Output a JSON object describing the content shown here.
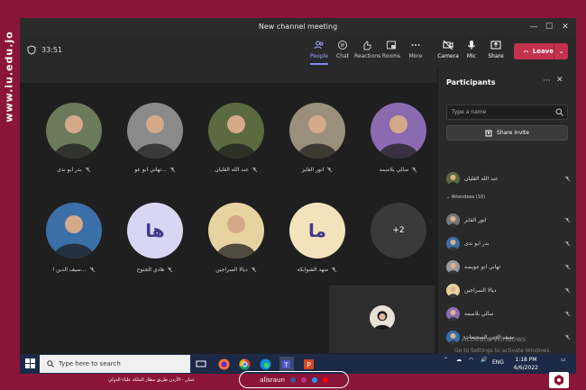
{
  "side_text": "www.iu.edu.jo",
  "window": {
    "title": "New channel meeting",
    "min": "—",
    "max": "☐",
    "close": "✕"
  },
  "toolbar": {
    "timer": "33:51",
    "buttons": [
      {
        "label": "People",
        "icon": "people-icon"
      },
      {
        "label": "Chat",
        "icon": "chat-icon"
      },
      {
        "label": "Reactions",
        "icon": "reactions-icon"
      },
      {
        "label": "Rooms",
        "icon": "rooms-icon"
      },
      {
        "label": "More",
        "icon": "more-icon"
      },
      {
        "label": "Camera",
        "icon": "camera-off-icon"
      },
      {
        "label": "Mic",
        "icon": "mic-icon"
      },
      {
        "label": "Share",
        "icon": "share-icon"
      }
    ],
    "leave_label": "Leave"
  },
  "tiles": [
    {
      "name": "بدر ابو ندى",
      "kind": "photo",
      "color": "#6b7a5a"
    },
    {
      "name": "تهاني ابو عو...",
      "kind": "photo",
      "color": "#8a8a8a"
    },
    {
      "name": "عبد الله القليان",
      "kind": "photo",
      "color": "#5b6a3f"
    },
    {
      "name": "انور الفايز",
      "kind": "photo",
      "color": "#9a8f7a"
    },
    {
      "name": "سالي بلاسمه",
      "kind": "photo",
      "color": "#8a6bb0"
    },
    {
      "name": "سيف الدين ا...",
      "kind": "photo",
      "color": "#3a6fa8"
    },
    {
      "name": "هادي الجنوح",
      "kind": "initials",
      "initials": "ها",
      "color": "#d8d6f2"
    },
    {
      "name": "ديالا السراجين",
      "kind": "photo",
      "color": "#e7d3a0"
    },
    {
      "name": "سهد الشوابكه",
      "kind": "initials",
      "initials": "ما",
      "color": "#f3e3bc"
    },
    {
      "name": "",
      "kind": "overflow",
      "initials": "+2",
      "color": "#3a3a3a"
    }
  ],
  "participants": {
    "title": "Participants",
    "search_placeholder": "Type a name",
    "share_invite": "Share invite",
    "organizer": "عبد الله القليان",
    "attendees_label": "Attendees (10)",
    "list": [
      "انور الفايز",
      "بدر ابو ندى",
      "تهاني ابو عويضه",
      "ديالا السراجين",
      "سالي بلاسمه",
      "سيف الدين السحيمات",
      "لارا عبيد"
    ]
  },
  "watermark": {
    "line1": "Activate Windows",
    "line2": "Go to Settings to activate Windows."
  },
  "taskbar": {
    "search_placeholder": "Type here to search",
    "time": "1:18 PM",
    "date": "6/6/2022",
    "lang": "ENG"
  },
  "footer": {
    "address": "عمان - الأردن طريق مطار الملكة علياء الدولي",
    "handle": "alisraun"
  }
}
